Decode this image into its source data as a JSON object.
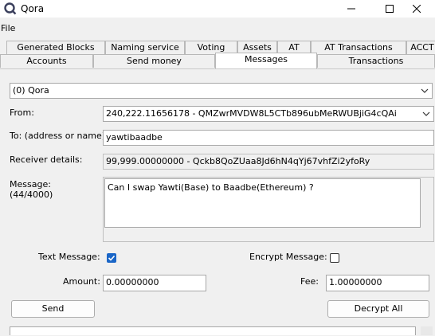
{
  "window": {
    "title": "Qora"
  },
  "menu": {
    "file": "File"
  },
  "tabs_row1": [
    "Generated Blocks",
    "Naming service",
    "Voting",
    "Assets",
    "AT",
    "AT Transactions",
    "ACCT"
  ],
  "tabs_row2": [
    "Accounts",
    "Send money",
    "Messages",
    "Transactions"
  ],
  "active_tab": "Messages",
  "asset_select": "(0) Qora",
  "form": {
    "from_label": "From:",
    "from_value": "240,222.11656178 - QMZwrMVDW8L5CTb896ubMeRWUBjiG4cQAi",
    "to_label": "To: (address or name)",
    "to_value": "yawtibaadbe",
    "receiver_label": "Receiver details:",
    "receiver_value": "99,999.00000000 - Qckb8QoZUaa8Jd6hN4qYj67vhfZi2yfoRy",
    "message_label": "Message:",
    "message_count": "(44/4000)",
    "message_value": "Can I swap Yawti(Base) to Baadbe(Ethereum) ?",
    "text_message_label": "Text Message:",
    "text_message_checked": true,
    "encrypt_label": "Encrypt Message:",
    "encrypt_checked": false,
    "amount_label": "Amount:",
    "amount_value": "0.00000000",
    "fee_label": "Fee:",
    "fee_value": "1.00000000",
    "send_label": "Send",
    "decrypt_label": "Decrypt All"
  },
  "colors": {
    "accent": "#1a66c7",
    "border": "#a8a8a8"
  }
}
